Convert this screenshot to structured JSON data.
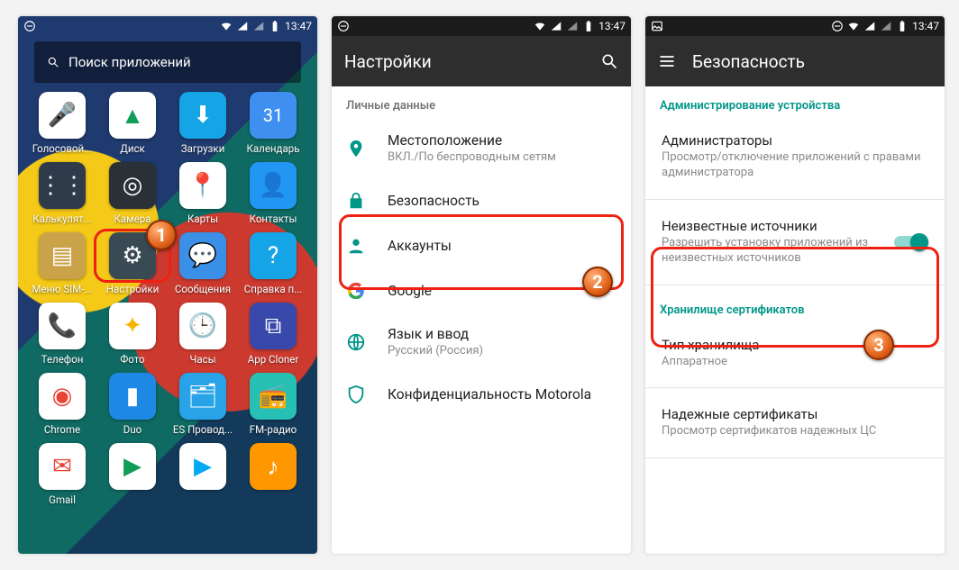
{
  "statusbar": {
    "time": "13:47"
  },
  "panel1": {
    "search_placeholder": "Поиск приложений",
    "apps": [
      {
        "label": "Голосовой...",
        "bg": "#ffffff",
        "glyph": "🎤",
        "fg": "#4285f4"
      },
      {
        "label": "Диск",
        "bg": "#ffffff",
        "glyph": "▲",
        "fg": "#0f9d58"
      },
      {
        "label": "Загрузки",
        "bg": "#15a4e6",
        "glyph": "⬇"
      },
      {
        "label": "Календарь",
        "bg": "#3f8ff0",
        "glyph": "31"
      },
      {
        "label": "Калькулят...",
        "bg": "#2f3a4a",
        "glyph": "⋮⋮"
      },
      {
        "label": "Камера",
        "bg": "#2a3136",
        "glyph": "◎"
      },
      {
        "label": "Карты",
        "bg": "#ffffff",
        "glyph": "📍",
        "fg": "#0f9d58"
      },
      {
        "label": "Контакты",
        "bg": "#2196f3",
        "glyph": "👤"
      },
      {
        "label": "Меню SIM-...",
        "bg": "#c9a24a",
        "glyph": "▤"
      },
      {
        "label": "Настройки",
        "bg": "#3a4a54",
        "glyph": "⚙"
      },
      {
        "label": "Сообщения",
        "bg": "#3a8fe6",
        "glyph": "💬"
      },
      {
        "label": "Справка п...",
        "bg": "#15a4e6",
        "glyph": "?"
      },
      {
        "label": "Телефон",
        "bg": "#ffffff",
        "glyph": "📞",
        "fg": "#1e88e5"
      },
      {
        "label": "Фото",
        "bg": "#ffffff",
        "glyph": "✦",
        "fg": "#f4b400"
      },
      {
        "label": "Часы",
        "bg": "#ffffff",
        "glyph": "🕒",
        "fg": "#1e88e5"
      },
      {
        "label": "App Cloner",
        "bg": "#3949ab",
        "glyph": "⧉"
      },
      {
        "label": "Chrome",
        "bg": "#ffffff",
        "glyph": "◉",
        "fg": "#ea4335"
      },
      {
        "label": "Duo",
        "bg": "#1e88e5",
        "glyph": "▮"
      },
      {
        "label": "ES Провод...",
        "bg": "#29a3e8",
        "glyph": "🗂"
      },
      {
        "label": "FM-радио",
        "bg": "#26c0b4",
        "glyph": "📻"
      },
      {
        "label": "Gmail",
        "bg": "#ffffff",
        "glyph": "✉",
        "fg": "#ea4335"
      },
      {
        "label": "",
        "bg": "#ffffff",
        "glyph": "▶",
        "fg": "#0f9d58"
      },
      {
        "label": "",
        "bg": "#ffffff",
        "glyph": "▶",
        "fg": "#03a9f4"
      },
      {
        "label": "",
        "bg": "#ff9800",
        "glyph": "♪"
      }
    ]
  },
  "panel2": {
    "title": "Настройки",
    "section_personal": "Личные данные",
    "rows": [
      {
        "icon": "location",
        "title": "Местоположение",
        "sub": "ВКЛ./По беспроводным сетям"
      },
      {
        "icon": "lock",
        "title": "Безопасность"
      },
      {
        "icon": "person",
        "title": "Аккаунты"
      },
      {
        "icon": "google",
        "title": "Google"
      },
      {
        "icon": "globe",
        "title": "Язык и ввод",
        "sub": "Русский (Россия)"
      },
      {
        "icon": "shield",
        "title": "Конфиденциальность Motorola"
      }
    ]
  },
  "panel3": {
    "title": "Безопасность",
    "sec_admin": "Администрирование устройства",
    "row_admins": {
      "title": "Администраторы",
      "sub": "Просмотр/отключение приложений с правами администратора"
    },
    "row_unknown": {
      "title": "Неизвестные источники",
      "sub": "Разрешить установку приложений из неизвестных источников"
    },
    "sec_cert": "Хранилище сертификатов",
    "row_store": {
      "title": "Тип хранилища",
      "sub": "Аппаратное"
    },
    "row_trusted": {
      "title": "Надежные сертификаты",
      "sub": "Просмотр сертификатов надежных ЦС"
    }
  },
  "steps": {
    "s1": "1",
    "s2": "2",
    "s3": "3"
  }
}
